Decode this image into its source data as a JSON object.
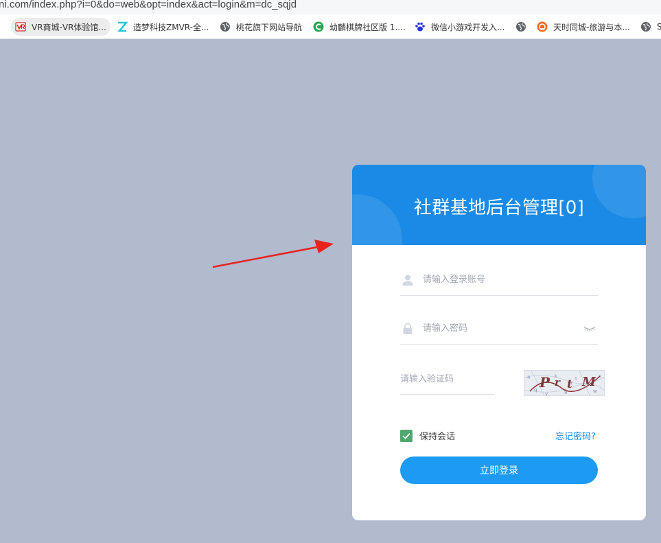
{
  "browser": {
    "url": "ni.com/index.php?i=0&do=web&opt=index&act=login&m=dc_sqjd",
    "bookmarks": [
      {
        "label": "VR商城-VR体验馆...",
        "icon": "vr-logo-icon",
        "active": true
      },
      {
        "label": "造梦科技ZMVR-全...",
        "icon": "z-logo-icon"
      },
      {
        "label": "桃花旗下网站导航",
        "icon": "globe-icon"
      },
      {
        "label": "幼麟棋牌社区版 1....",
        "icon": "c-logo-icon"
      },
      {
        "label": "微信小游戏开发入...",
        "icon": "baidu-paw-icon"
      },
      {
        "label": "",
        "icon": "globe-icon"
      },
      {
        "label": "天时同城-旅游与本...",
        "icon": "tianshi-logo-icon"
      },
      {
        "label": "S",
        "icon": "globe-icon"
      }
    ]
  },
  "login": {
    "title": "社群基地后台管理[0]",
    "username_placeholder": "请输入登录账号",
    "password_placeholder": "请输入密码",
    "captcha_placeholder": "请输入验证码",
    "captcha_text": "PrtM",
    "remember_label": "保持会话",
    "remember_checked": true,
    "forgot_label": "忘记密码?",
    "submit_label": "立即登录"
  },
  "colors": {
    "page_bg": "#b2bacd",
    "header_blue": "#1a8ae6",
    "button_blue": "#1d9bf4",
    "checkbox_green": "#50a86f",
    "arrow_red": "#e8231c"
  }
}
